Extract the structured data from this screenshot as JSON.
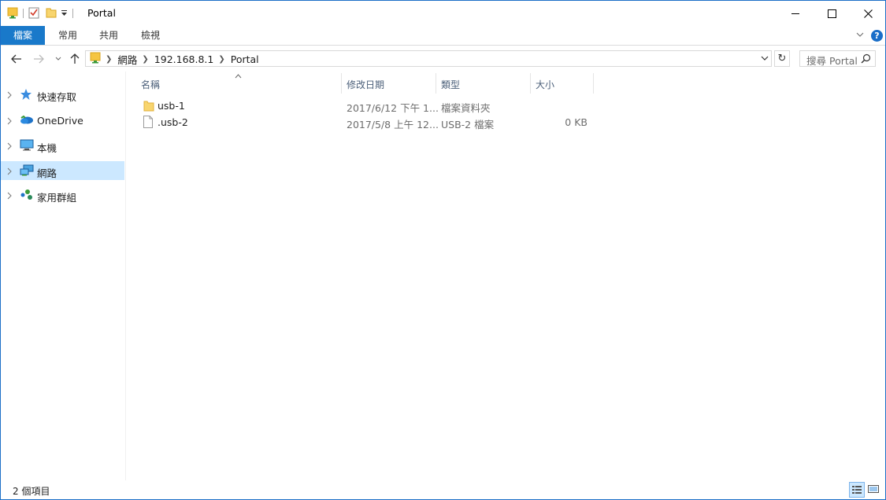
{
  "window": {
    "title": "Portal",
    "buttons": {
      "minimize": "minimize-icon",
      "maximize": "maximize-icon",
      "close": "close-icon"
    }
  },
  "ribbon": {
    "tabs": [
      "檔案",
      "常用",
      "共用",
      "檢視"
    ],
    "help": "?"
  },
  "address": {
    "crumbs": [
      "網路",
      "192.168.8.1",
      "Portal"
    ],
    "search_placeholder": "搜尋 Portal"
  },
  "nav": {
    "items": [
      {
        "label": "快速存取",
        "icon": "quick-access-star-icon",
        "selected": false
      },
      {
        "label": "OneDrive",
        "icon": "onedrive-cloud-icon",
        "selected": false
      },
      {
        "label": "本機",
        "icon": "this-pc-icon",
        "selected": false
      },
      {
        "label": "網路",
        "icon": "network-icon",
        "selected": true
      },
      {
        "label": "家用群組",
        "icon": "homegroup-icon",
        "selected": false
      }
    ]
  },
  "columns": [
    "名稱",
    "修改日期",
    "類型",
    "大小"
  ],
  "files": [
    {
      "name": "usb-1",
      "date": "2017/6/12 下午 1...",
      "type": "檔案資料夾",
      "size": "",
      "icon": "folder-icon"
    },
    {
      "name": ".usb-2",
      "date": "2017/5/8 上午 12...",
      "type": "USB-2 檔案",
      "size": "0 KB",
      "icon": "file-icon"
    }
  ],
  "status": {
    "count": "2 個項目"
  },
  "colors": {
    "accent": "#1979ca",
    "selected": "#cce8ff",
    "header_text": "#4c607a"
  }
}
